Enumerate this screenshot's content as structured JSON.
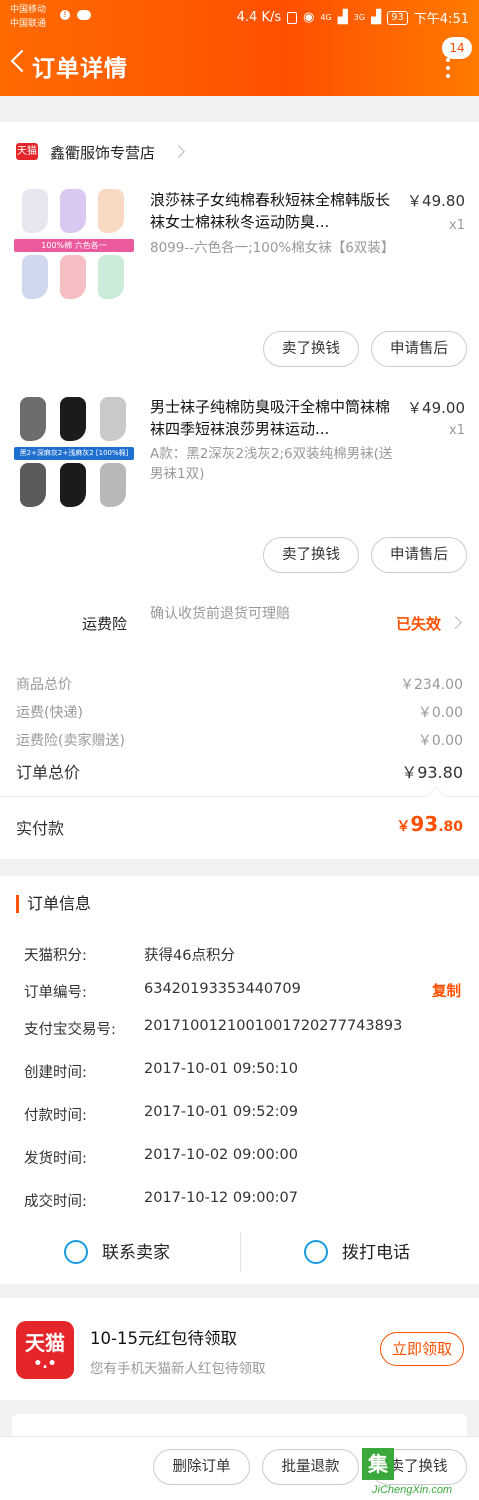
{
  "status_bar": {
    "carrier1": "中国移动",
    "carrier2": "中国联通",
    "speed": "4.4 K/s",
    "signal1": "4G",
    "signal2": "3G",
    "battery": "93",
    "time": "下午4:51"
  },
  "header": {
    "title": "订单详情",
    "message_count": "14"
  },
  "store": {
    "badge": "天猫",
    "name": "鑫衢服饰专营店"
  },
  "products": [
    {
      "title": "浪莎袜子女纯棉春秋短袜全棉韩版长袜女士棉袜秋冬运动防臭...",
      "price": "￥49.80",
      "qty": "x1",
      "sku": "8099--六色各一;100%棉女袜【6双装】",
      "thumb_caption": "100%棉 六色各一",
      "btn_exchange": "卖了换钱",
      "btn_aftersale": "申请售后"
    },
    {
      "title": "男士袜子纯棉防臭吸汗全棉中筒袜棉袜四季短袜浪莎男袜运动...",
      "price": "￥49.00",
      "qty": "x1",
      "sku": "A款：黑2深灰2浅灰2;6双装纯棉男袜(送男袜1双)",
      "thumb_caption": "黑2+深麻灰2+浅麻灰2 [100%棉]",
      "btn_exchange": "卖了换钱",
      "btn_aftersale": "申请售后"
    }
  ],
  "insurance": {
    "label": "运费险",
    "desc": "确认收货前退货可理赔",
    "status": "已失效"
  },
  "totals": {
    "goods_label": "商品总价",
    "goods_value": "￥234.00",
    "shipping_label": "运费(快递)",
    "shipping_value": "￥0.00",
    "ins_label": "运费险(卖家赠送)",
    "ins_value": "￥0.00",
    "order_total_label": "订单总价",
    "order_total_value": "￥93.80",
    "paid_label": "实付款",
    "paid_yen": "￥",
    "paid_int": "93",
    "paid_dec": ".80"
  },
  "order_info": {
    "title": "订单信息",
    "copy_label": "复制",
    "rows": [
      {
        "k": "天猫积分:",
        "v": "获得46点积分"
      },
      {
        "k": "订单编号:",
        "v": "63420193353440709"
      },
      {
        "k": "支付宝交易号:",
        "v": "2017100121001001720277743893"
      },
      {
        "k": "创建时间:",
        "v": "2017-10-01 09:50:10"
      },
      {
        "k": "付款时间:",
        "v": "2017-10-01 09:52:09"
      },
      {
        "k": "发货时间:",
        "v": "2017-10-02 09:00:00"
      },
      {
        "k": "成交时间:",
        "v": "2017-10-12 09:00:07"
      }
    ],
    "contact_seller": "联系卖家",
    "call_phone": "拨打电话"
  },
  "promo": {
    "logo": "天猫",
    "title": "10-15元红包待领取",
    "subtitle": "您有手机天猫新人红包待领取",
    "button": "立即领取"
  },
  "bottom_bar": {
    "delete": "删除订单",
    "batch_refund": "批量退款",
    "sell": "卖了换钱"
  },
  "watermark": {
    "char": "集",
    "text": "JiChengXin.com"
  },
  "colors": {
    "accent": "#ff5000",
    "tmall_red": "#e4262a",
    "link_blue": "#1a9be0"
  }
}
